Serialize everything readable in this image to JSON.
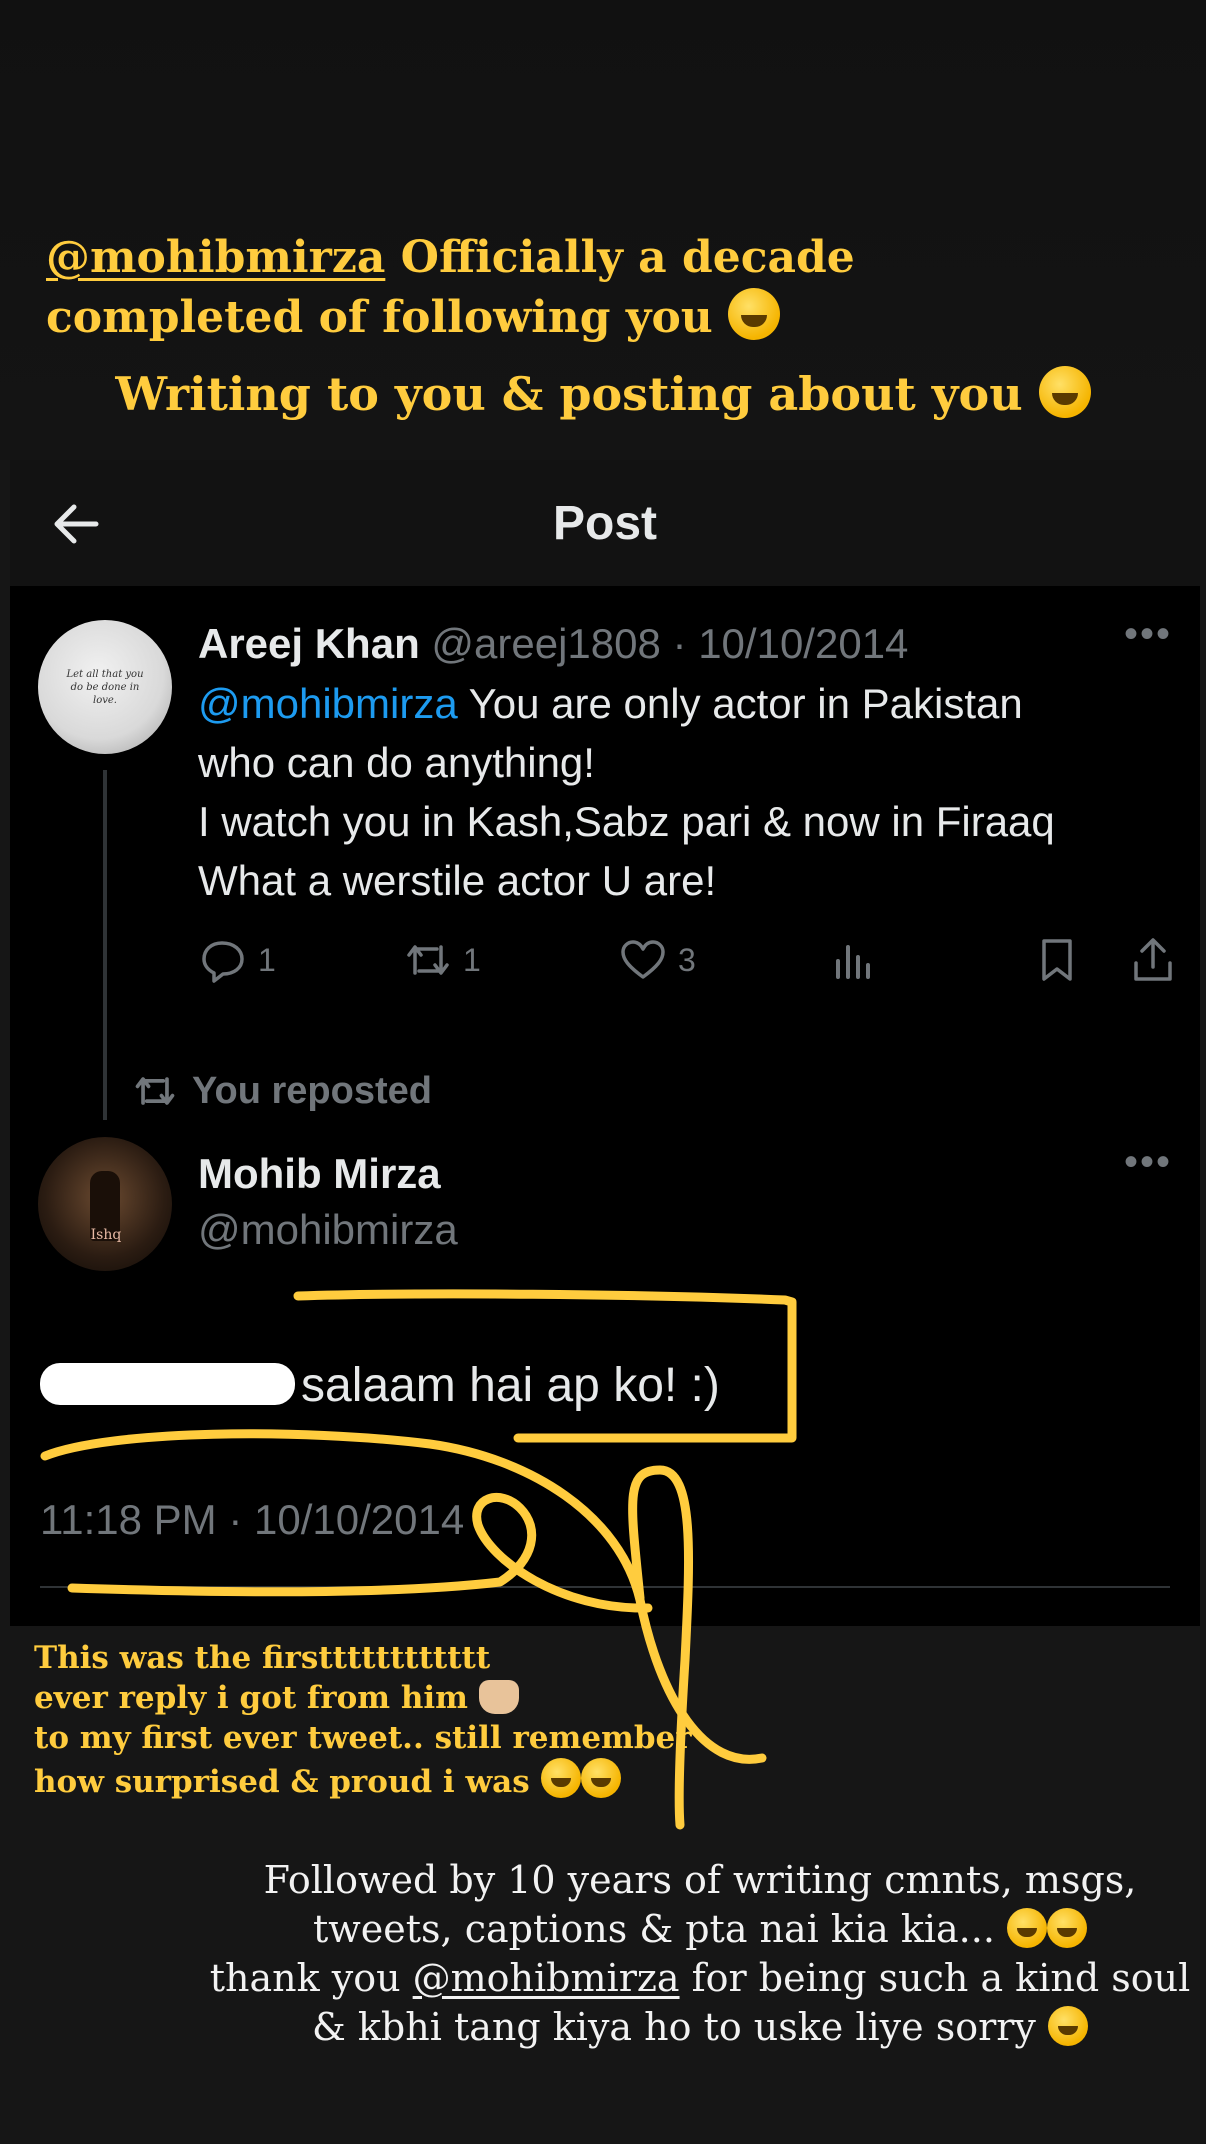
{
  "story": {
    "caption_mention": "@mohibmirza",
    "caption_line1_rest": " Officially a decade",
    "caption_line2": "completed of following you",
    "caption_line3": "Writing to you & posting about you"
  },
  "header": {
    "title": "Post",
    "back_icon": "arrow-left-icon"
  },
  "original_tweet": {
    "name": "Areej Khan",
    "handle": "@areej1808",
    "separator": " · ",
    "date": "10/10/2014",
    "avatar_text": "Let all that you do be done in love.",
    "mention": "@mohibmirza",
    "line1_rest": " You are only actor in Pakistan",
    "line2": "who can do anything!",
    "line3": "I watch you in Kash,Sabz pari & now in Firaaq",
    "line4": "What a werstile actor U are!",
    "stats": {
      "replies": "1",
      "reposts": "1",
      "likes": "3"
    }
  },
  "repost_label": "You reposted",
  "reply": {
    "name": "Mohib Mirza",
    "handle": "@mohibmirza",
    "avatar_text": "Ishq",
    "text": "salaam hai ap ko! :)",
    "time": "11:18 PM · 10/10/2014"
  },
  "note_left": {
    "line1": "This was the firstttttttttttt",
    "line2": "ever reply i got from him",
    "line3": "to my first ever tweet.. still remember",
    "line4": "how surprised & proud i was"
  },
  "note_right": {
    "line1": "Followed by 10 years of writing cmnts, msgs,",
    "line2": "tweets, captions & pta nai kia kia...",
    "line3_pre": "thank you ",
    "line3_mention": "@mohibmirza",
    "line3_post": " for being such a kind soul",
    "line4": "& kbhi tang kiya ho to uske liye sorry"
  },
  "colors": {
    "caption": "#ffcc3e",
    "link": "#1d9bf0",
    "muted": "#71767b",
    "background": "#000000"
  }
}
